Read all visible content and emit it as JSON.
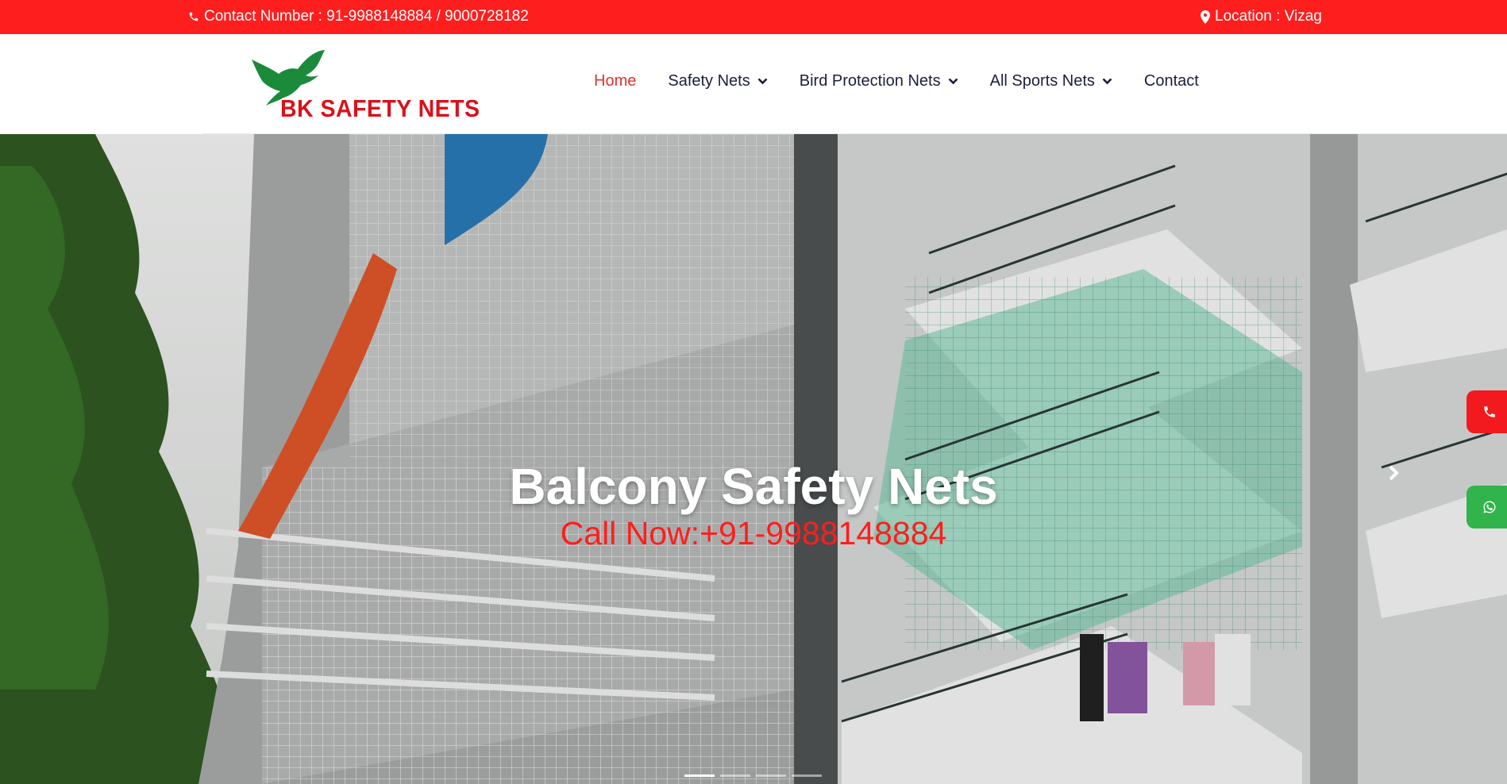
{
  "topbar": {
    "contact_text": "Contact Number : 91-9988148884 / 9000728182",
    "location_text": "Location : Vizag",
    "contact_icon": "phone-icon",
    "location_icon": "map-marker-icon"
  },
  "brand": {
    "name": "BK SAFETY NETS",
    "logo_icon": "bird-icon",
    "logo_color": "#1b8a3a",
    "text_color": "#d8121a"
  },
  "nav": {
    "items": [
      {
        "label": "Home",
        "active": true
      },
      {
        "label": "Safety Nets",
        "dropdown": true
      },
      {
        "label": "Bird Protection Nets",
        "dropdown": true
      },
      {
        "label": "All Sports Nets",
        "dropdown": true
      },
      {
        "label": "Contact"
      }
    ],
    "active_color": "#e2302d"
  },
  "hero": {
    "title": "Balcony Safety Nets",
    "subtitle": "Call Now:+91-9988148884",
    "next_icon": "chevron-right-icon",
    "slide_count": 4,
    "active_slide": 1
  },
  "floating": {
    "call_icon": "phone-icon",
    "whatsapp_icon": "whatsapp-icon",
    "call_color": "#f21a1e",
    "whatsapp_color": "#31b44b"
  },
  "colors": {
    "topbar_bg": "#ff1e1e",
    "nav_text": "#1b1f3b"
  }
}
